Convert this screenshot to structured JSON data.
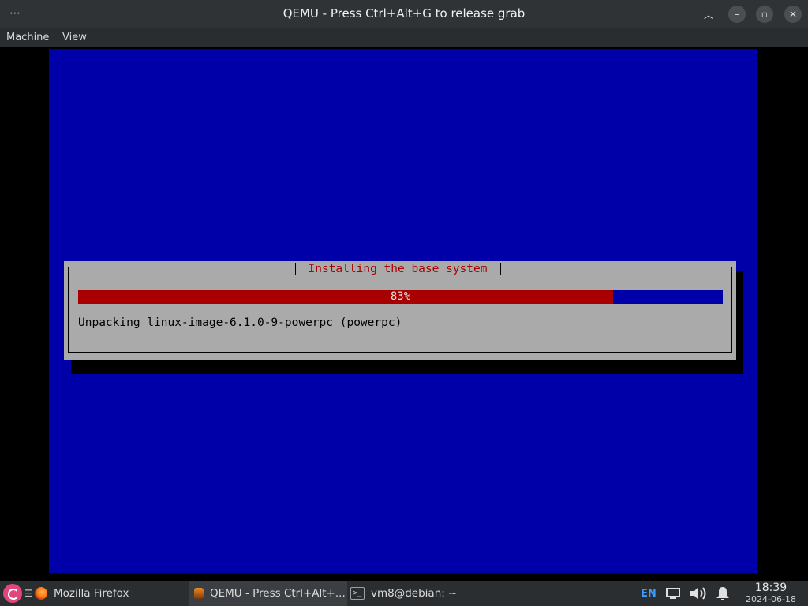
{
  "window": {
    "title": "QEMU - Press Ctrl+Alt+G to release grab",
    "menu_icon": "ellipsis-icon"
  },
  "menubar": {
    "items": [
      "Machine",
      "View"
    ]
  },
  "installer": {
    "dialog_title": "Installing the base system",
    "progress_percent": 83,
    "progress_label": "83%",
    "status_text": "Unpacking linux-image-6.1.0-9-powerpc (powerpc)",
    "colors": {
      "screen": "#0000a8",
      "dialog": "#aaaaaa",
      "progress_fill": "#a80000",
      "title_text": "#a80000"
    }
  },
  "taskbar": {
    "menu_glyph": "☰",
    "tasks": [
      {
        "label": "Mozilla Firefox",
        "icon": "firefox-icon"
      },
      {
        "label": "QEMU - Press Ctrl+Alt+...",
        "icon": "qemu-icon",
        "active": true
      },
      {
        "label": "vm8@debian: ~",
        "icon": "terminal-icon"
      }
    ],
    "tray": {
      "lang": "EN",
      "time": "18:39",
      "date": "2024-06-18"
    }
  }
}
